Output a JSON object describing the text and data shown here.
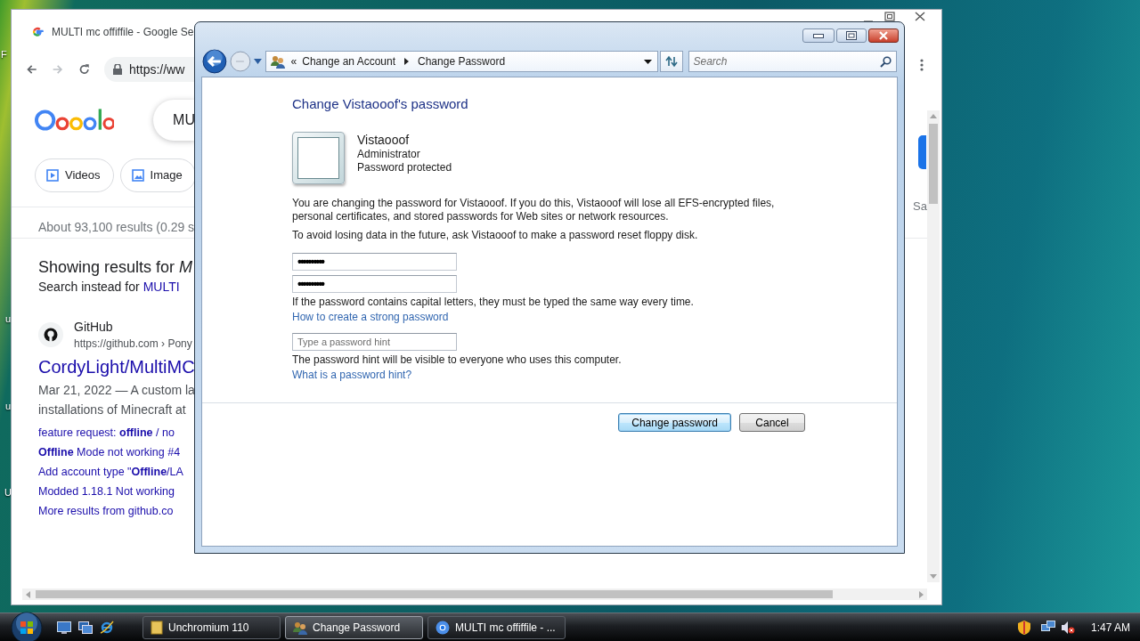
{
  "desktop": {
    "labels": [
      "F",
      "u",
      "u",
      "U"
    ]
  },
  "browser": {
    "tab_title": "MULTI mc offiffile - Google Se",
    "url": "https://ww",
    "search_query": "MU",
    "filters": [
      {
        "label": "Videos"
      },
      {
        "label": "Image"
      }
    ],
    "result_stats": "About 93,100 results (0.29 s",
    "showing_for": "Showing results for *M*",
    "search_instead_label": "Search instead for",
    "search_instead_link": "MULTI",
    "result": {
      "site": "GitHub",
      "cite": "https://github.com › Pony",
      "title": "CordyLight/MultiMC",
      "snippet": [
        "Mar 21, 2022 — A custom la",
        "installations of Minecraft at"
      ],
      "sitelinks": [
        "feature request: **offline** / no",
        "**Offline** Mode not working #4",
        "Add account type \"**Offline**/LA",
        "Modded 1.18.1 Not working",
        "More results from github.co"
      ]
    },
    "right_fragment": "Sa"
  },
  "dialog": {
    "breadcrumb_overflow": "«",
    "breadcrumb": [
      "Change an Account",
      "Change Password"
    ],
    "search_placeholder": "Search",
    "heading": "Change Vistaooof's password",
    "account": {
      "name": "Vistaooof",
      "role": "Administrator",
      "status": "Password protected"
    },
    "paragraphs": [
      "You are changing the password for Vistaooof.  If you do this, Vistaooof will lose all EFS-encrypted files, personal certificates, and stored passwords for Web sites or network resources.",
      "To avoid losing data in the future, ask Vistaooof to make a password reset floppy disk."
    ],
    "password_fields": [
      {
        "value": "••••••••••"
      },
      {
        "value": "••••••••••"
      }
    ],
    "caps_note": "If the password contains capital letters, they must be typed the same way every time.",
    "strong_link": "How to create a strong password",
    "hint_placeholder": "Type a password hint",
    "hint_note": "The password hint will be visible to everyone who uses this computer.",
    "hint_link": "What is a password hint?",
    "buttons": [
      {
        "label": "Change password",
        "default": true
      },
      {
        "label": "Cancel",
        "default": false
      }
    ]
  },
  "taskbar": {
    "tasks": [
      {
        "label": "Unchromium 110",
        "kind": "folder",
        "selected": false
      },
      {
        "label": "Change Password",
        "kind": "users",
        "selected": true
      },
      {
        "label": "MULTI mc offiffile - ...",
        "kind": "browser",
        "selected": false
      }
    ],
    "clock": "1:47 AM"
  }
}
